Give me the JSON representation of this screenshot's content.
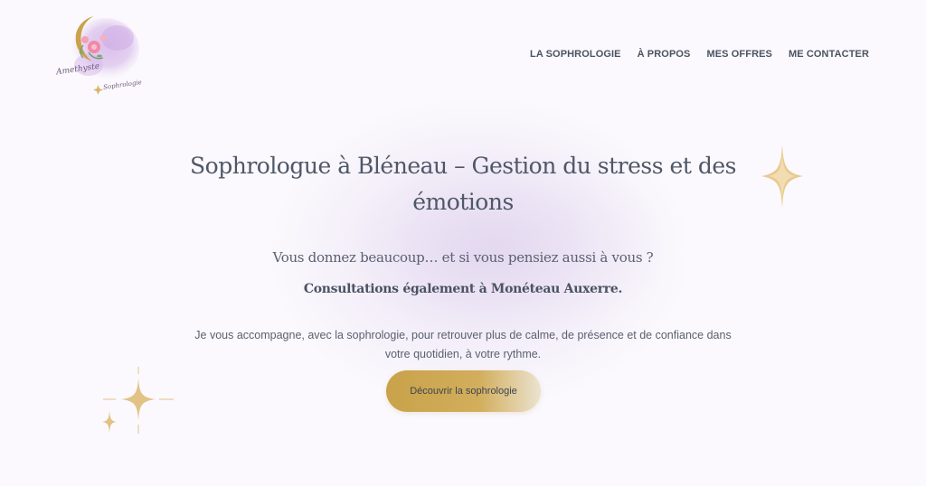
{
  "header": {
    "logo": {
      "script_text": "Amethyste",
      "sub_text": "Sophrologie"
    },
    "nav": [
      {
        "label": "LA SOPHROLOGIE"
      },
      {
        "label": "À PROPOS"
      },
      {
        "label": "MES OFFRES"
      },
      {
        "label": "ME CONTACTER"
      }
    ]
  },
  "hero": {
    "title": "Sophrologue à Bléneau – Gestion du stress et des émotions",
    "subtitle": "Vous donnez beaucoup… et si vous pensiez aussi à vous ?",
    "consultations": "Consultations également à Monéteau Auxerre.",
    "text": "Je vous accompagne, avec la sophrologie, pour retrouver plus de calme, de présence et de confiance dans votre quotidien, à votre rythme.",
    "cta_label": "Découvrir la sophrologie"
  },
  "colors": {
    "background": "#fbf9fd",
    "text": "#4f5768",
    "accent_gold": "#c9a24a",
    "wash_lavender": "#dccdec"
  },
  "icons": [
    "sparkle-icon",
    "moon-flower-logo"
  ]
}
